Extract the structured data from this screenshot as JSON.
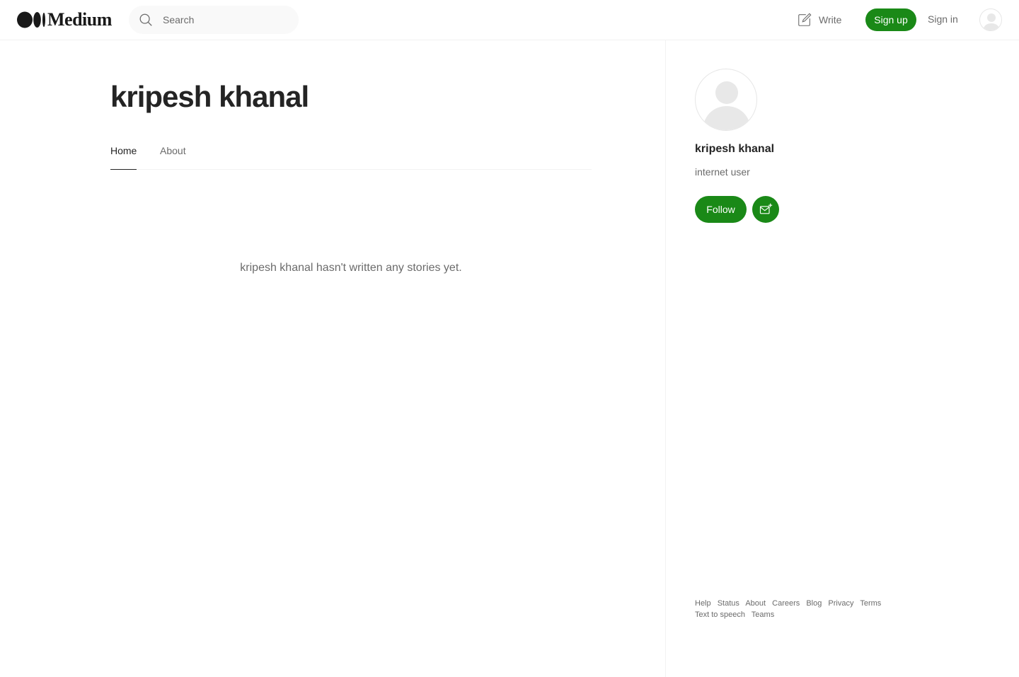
{
  "header": {
    "logo_text": "Medium",
    "search": {
      "placeholder": "Search"
    },
    "write_label": "Write",
    "signup_label": "Sign up",
    "signin_label": "Sign in"
  },
  "profile": {
    "name": "kripesh khanal",
    "tabs": [
      {
        "label": "Home",
        "active": true
      },
      {
        "label": "About",
        "active": false
      }
    ],
    "empty_message": "kripesh khanal hasn't written any stories yet."
  },
  "sidebar": {
    "name": "kripesh khanal",
    "bio": "internet user",
    "follow_label": "Follow",
    "footer_links": [
      "Help",
      "Status",
      "About",
      "Careers",
      "Blog",
      "Privacy",
      "Terms",
      "Text to speech",
      "Teams"
    ]
  },
  "colors": {
    "accent_green": "#1a8917",
    "text_primary": "#242424",
    "text_secondary": "#6b6b6b",
    "divider": "#f2f2f2"
  },
  "icons": [
    "medium-logo-icon",
    "search-icon",
    "write-icon",
    "user-avatar-icon",
    "subscribe-mail-icon"
  ]
}
